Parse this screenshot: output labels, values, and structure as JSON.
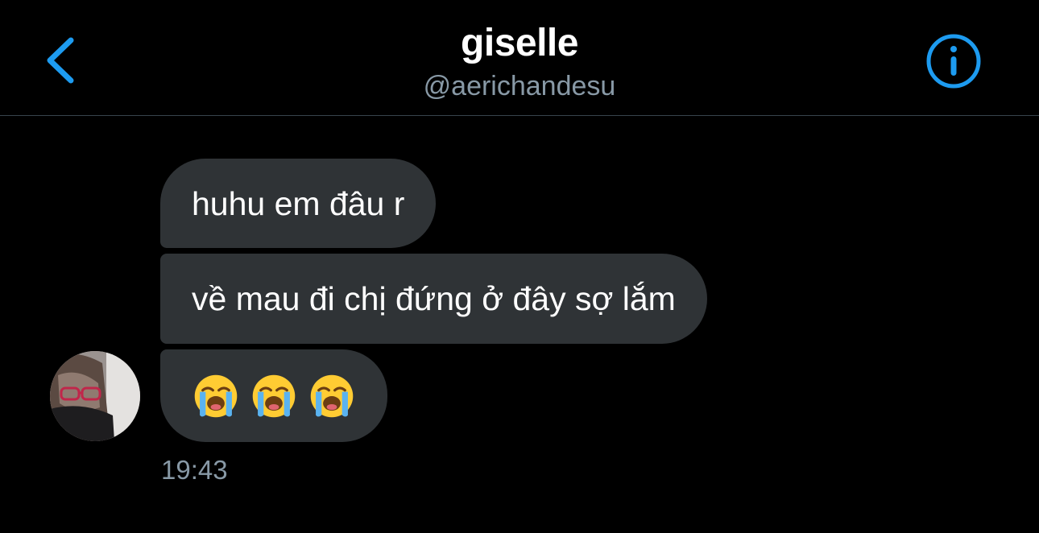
{
  "header": {
    "title": "giselle",
    "handle": "@aerichandesu",
    "back_icon": "chevron-left-icon",
    "info_icon": "info-circle-icon",
    "accent_color": "#1d9bf0"
  },
  "messages": [
    {
      "text": "huhu em đâu r"
    },
    {
      "text": "về mau đi chị đứng ở đây sợ lắm"
    },
    {
      "emojis": [
        "loudly-crying-face",
        "loudly-crying-face",
        "loudly-crying-face"
      ]
    }
  ],
  "timestamp": "19:43",
  "colors": {
    "background": "#000000",
    "bubble": "#2f3336",
    "secondary_text": "#8899a6",
    "divider": "#38444d"
  }
}
